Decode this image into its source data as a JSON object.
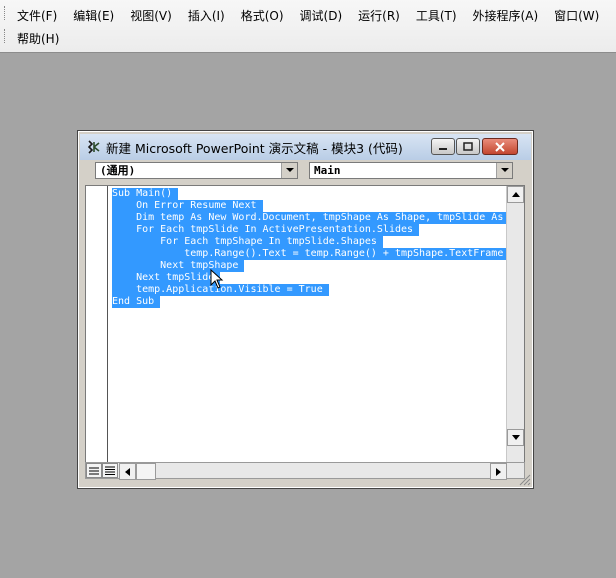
{
  "menubar": {
    "row1": [
      "文件(F)",
      "编辑(E)",
      "视图(V)",
      "插入(I)",
      "格式(O)",
      "调试(D)",
      "运行(R)",
      "工具(T)",
      "外接程序(A)",
      "窗口(W)"
    ],
    "row2": [
      "帮助(H)"
    ]
  },
  "code_window": {
    "title": "新建 Microsoft PowerPoint 演示文稿 - 模块3 (代码)",
    "object_combo": "(通用)",
    "procedure_combo": "Main",
    "code_lines": [
      "Sub Main()",
      "    On Error Resume Next",
      "    Dim temp As New Word.Document, tmpShape As Shape, tmpSlide As",
      "    For Each tmpSlide In ActivePresentation.Slides",
      "        For Each tmpShape In tmpSlide.Shapes",
      "            temp.Range().Text = temp.Range() + tmpShape.TextFrame",
      "        Next tmpShape",
      "    Next tmpSlide",
      "    temp.Application.Visible = True",
      "End Sub",
      ""
    ]
  },
  "colors": {
    "selection": "#3399ff",
    "background": "#a4a4a4"
  }
}
